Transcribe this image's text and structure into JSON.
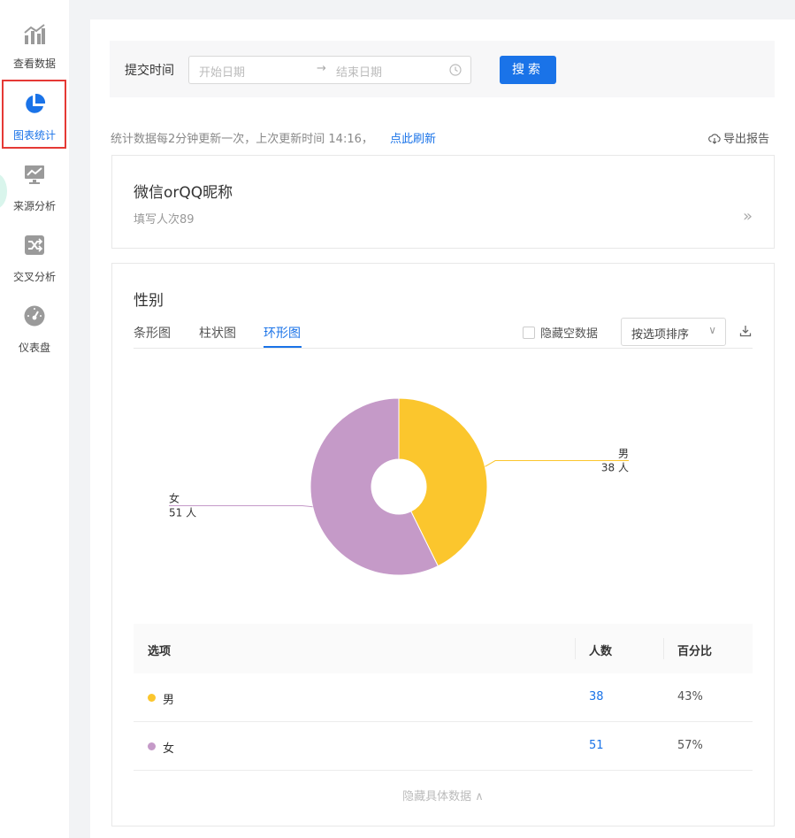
{
  "sidebar": {
    "items": [
      {
        "label": "查看数据",
        "icon": "bar-chart-icon"
      },
      {
        "label": "图表统计",
        "icon": "pie-chart-icon"
      },
      {
        "label": "来源分析",
        "icon": "monitor-trend-icon"
      },
      {
        "label": "交叉分析",
        "icon": "shuffle-icon"
      },
      {
        "label": "仪表盘",
        "icon": "gauge-icon"
      }
    ],
    "active_index": 1
  },
  "filter": {
    "label": "提交时间",
    "start_placeholder": "开始日期",
    "arrow": "→",
    "end_placeholder": "结束日期",
    "search_label": "搜索"
  },
  "stats": {
    "text": "统计数据每2分钟更新一次，上次更新时间 14:16，",
    "refresh_label": "点此刷新",
    "export_label": "导出报告"
  },
  "question": {
    "title": "微信orQQ昵称",
    "subtitle": "填写人次89",
    "expand": "»"
  },
  "gender": {
    "title": "性别",
    "tabs": [
      "条形图",
      "柱状图",
      "环形图"
    ],
    "active_tab": 2,
    "hide_empty_label": "隐藏空数据",
    "sort_label": "按选项排序",
    "sort_chevron": "∨"
  },
  "chart_data": {
    "type": "pie",
    "variant": "donut",
    "categories": [
      "男",
      "女"
    ],
    "values": [
      38,
      51
    ],
    "value_labels": [
      "38 人",
      "51 人"
    ],
    "colors": [
      "#fbc62d",
      "#c59ac8"
    ]
  },
  "table": {
    "headers": [
      "选项",
      "人数",
      "百分比"
    ],
    "rows": [
      {
        "option": "男",
        "count": "38",
        "percent": "43%",
        "color": "#fbc62d"
      },
      {
        "option": "女",
        "count": "51",
        "percent": "57%",
        "color": "#c59ac8"
      }
    ],
    "hide_detail_label": "隐藏具体数据 ∧"
  }
}
